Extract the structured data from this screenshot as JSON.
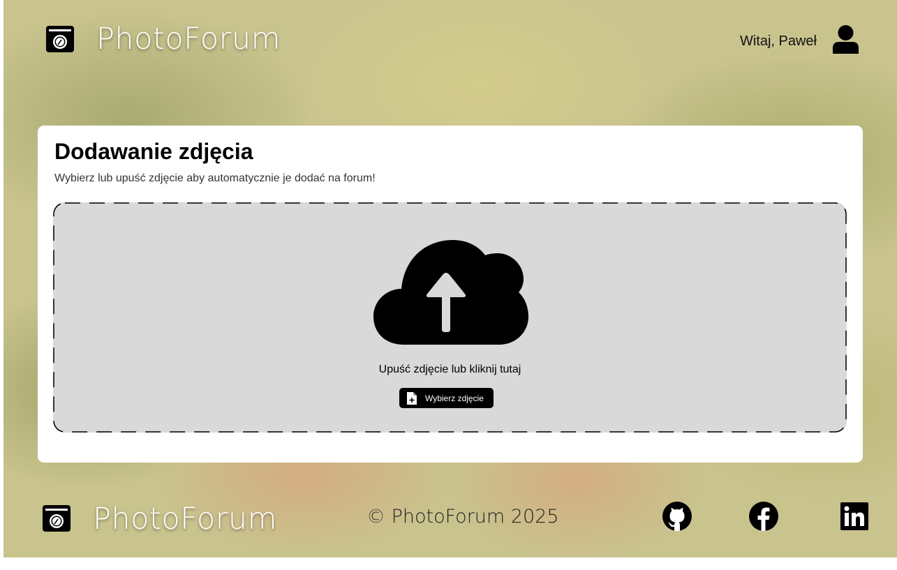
{
  "header": {
    "brand": "PhotoForum",
    "logo_icon": "camera-icon",
    "greeting": "Witaj, Paweł",
    "avatar_icon": "user-icon"
  },
  "upload": {
    "title": "Dodawanie zdjęcia",
    "subtitle": "Wybierz lub upuść zdjęcie aby automatycznie je dodać na forum!",
    "dropzone_icon": "cloud-upload-icon",
    "drop_text": "Upuść zdjęcie lub kliknij tutaj",
    "select_button_label": "Wybierz zdjęcie",
    "select_button_icon": "file-add-icon"
  },
  "footer": {
    "brand": "PhotoForum",
    "logo_icon": "camera-icon",
    "copyright": "© PhotoForum 2025",
    "social": [
      {
        "name": "GitHub",
        "icon": "github-icon"
      },
      {
        "name": "Facebook",
        "icon": "facebook-icon"
      },
      {
        "name": "LinkedIn",
        "icon": "linkedin-icon"
      }
    ]
  },
  "colors": {
    "accent": "#000000",
    "card_background": "#ffffff",
    "dropzone_background": "#d9d9d9",
    "brand_text": "#ffffff"
  }
}
